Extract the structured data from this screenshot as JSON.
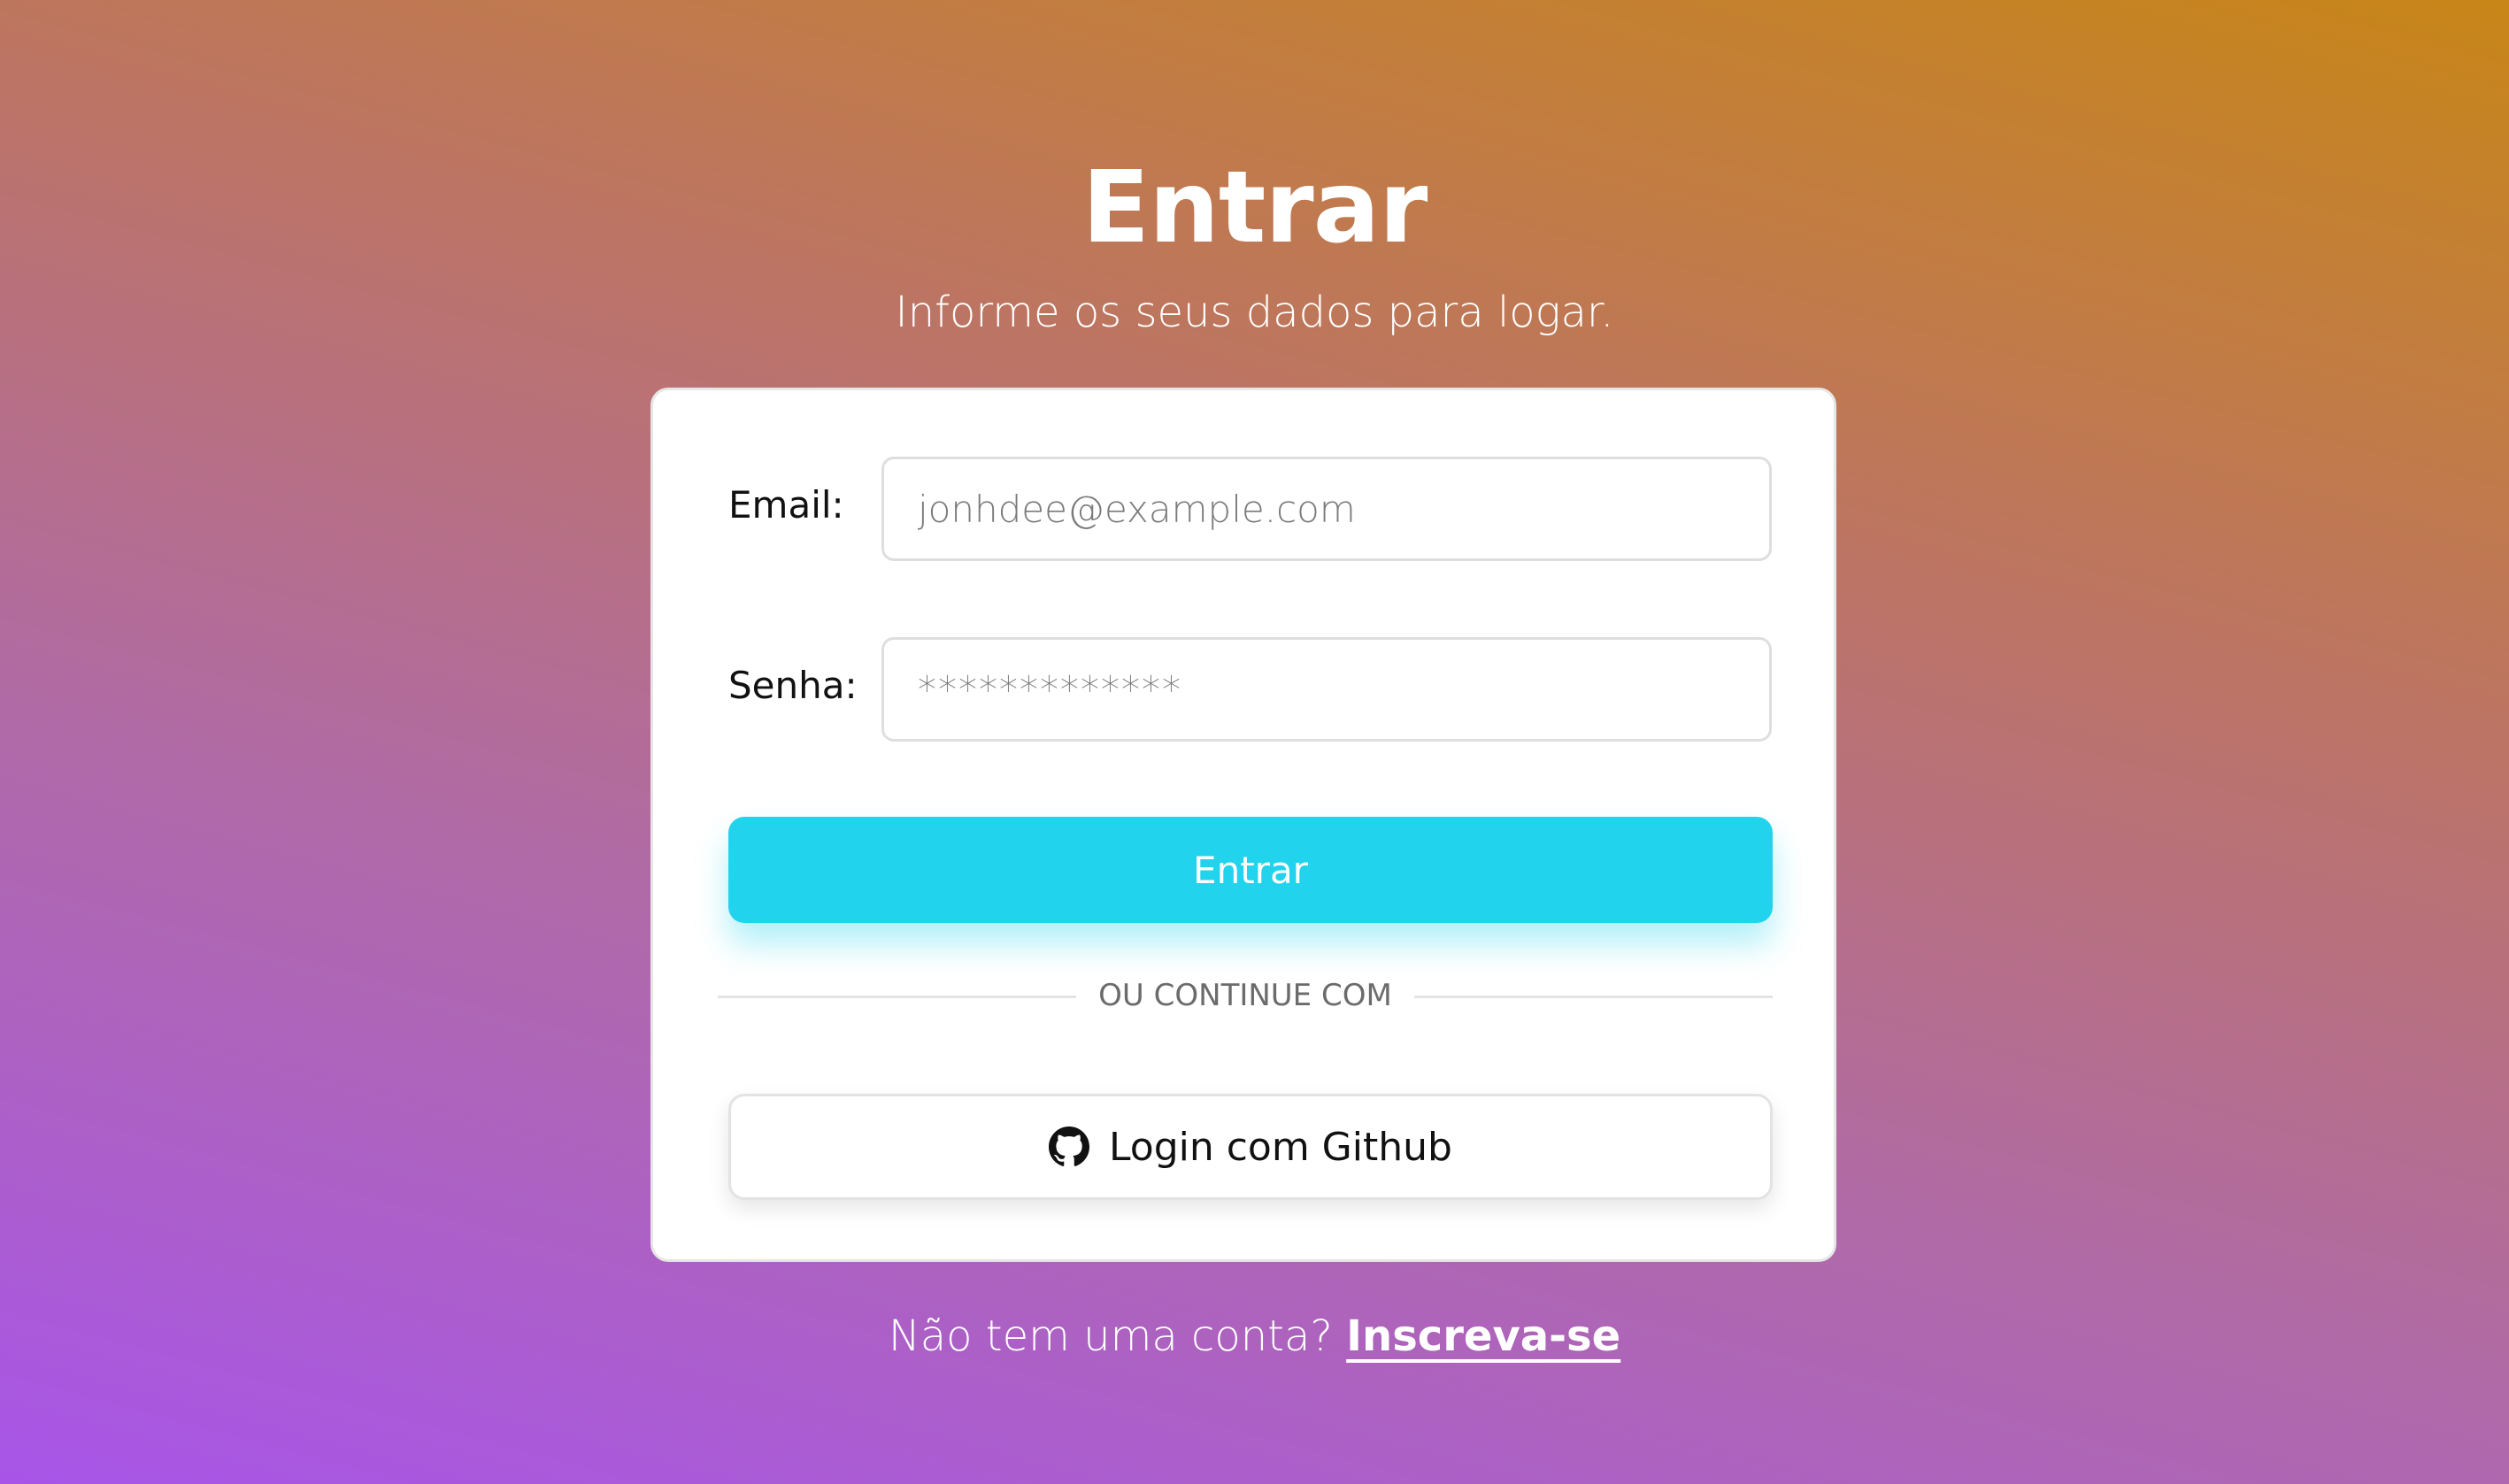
{
  "header": {
    "title": "Entrar",
    "subtitle": "Informe os seus dados para logar."
  },
  "form": {
    "email_label": "Email:",
    "email_placeholder": "jonhdee@example.com",
    "email_value": "",
    "password_label": "Senha:",
    "password_placeholder": "*************",
    "password_value": "",
    "submit_label": "Entrar",
    "divider_text": "OU CONTINUE COM",
    "github_label": "Login com Github",
    "github_icon": "github-icon"
  },
  "footer": {
    "prompt": "Não tem uma conta?",
    "signup_link": "Inscreva-se"
  },
  "colors": {
    "primary_button": "#21d3ec",
    "gradient_start": "#a855e8",
    "gradient_end": "#c88618",
    "card_background": "#ffffff"
  }
}
